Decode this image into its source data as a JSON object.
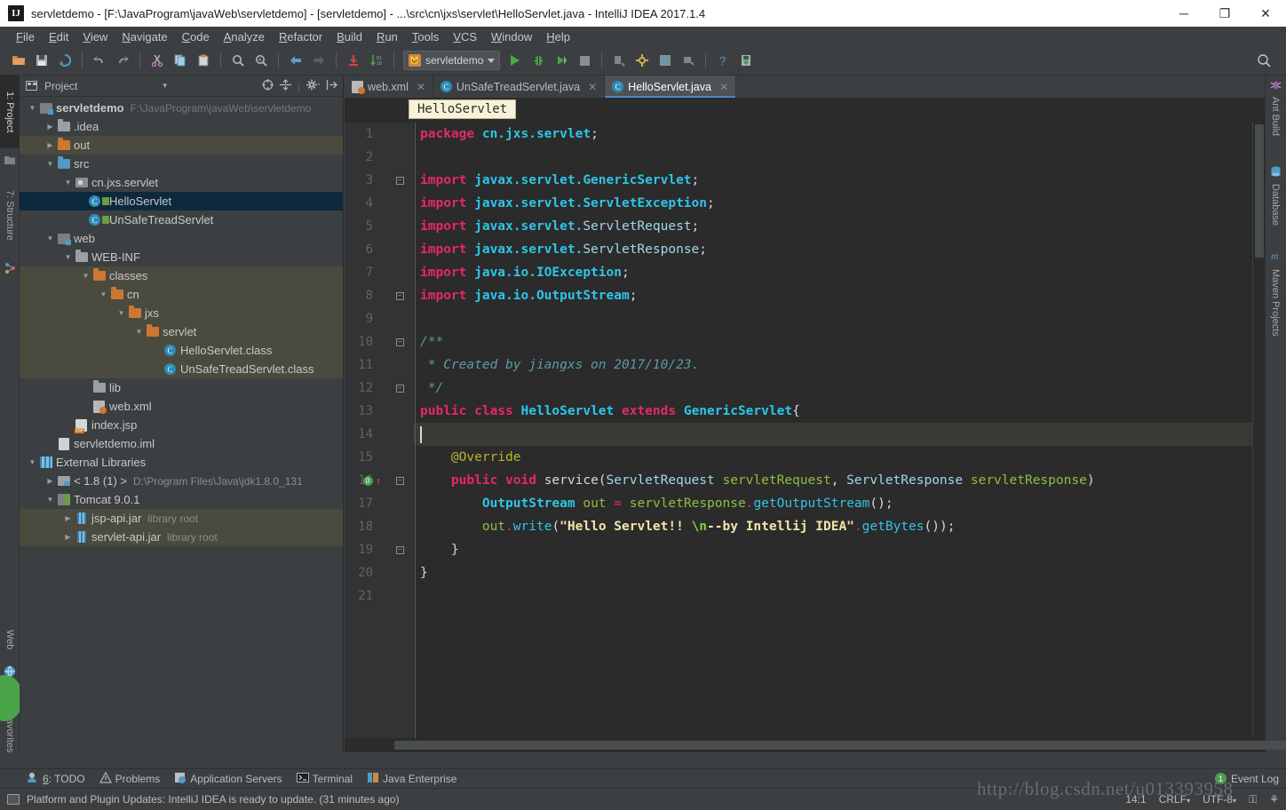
{
  "window": {
    "title": "servletdemo - [F:\\JavaProgram\\javaWeb\\servletdemo] - [servletdemo] - ...\\src\\cn\\jxs\\servlet\\HelloServlet.java - IntelliJ IDEA 2017.1.4",
    "logo": "IJ",
    "minimize": "─",
    "maximize": "❐",
    "close": "✕"
  },
  "menu": [
    "File",
    "Edit",
    "View",
    "Navigate",
    "Code",
    "Analyze",
    "Refactor",
    "Build",
    "Run",
    "Tools",
    "VCS",
    "Window",
    "Help"
  ],
  "toolbar": {
    "icons": [
      "open-folder-icon",
      "save-all-icon",
      "sync-icon",
      "undo-icon",
      "redo-icon",
      "cut-icon",
      "copy-icon",
      "paste-icon",
      "find-icon",
      "replace-icon",
      "back-icon",
      "forward-icon",
      "update-project-icon",
      "compare-icon"
    ],
    "run_config": "servletdemo",
    "run_icons": [
      "run-icon",
      "debug-icon",
      "run-coverage-icon",
      "stop-icon",
      "deploy-icon",
      "settings-icon",
      "project-structure-icon",
      "sdk-icon",
      "help-icon",
      "update-icon"
    ],
    "search": "⚲"
  },
  "left_strip": {
    "top_tabs": [
      {
        "label": "1: Project",
        "icon": "project-icon",
        "active": true
      },
      {
        "label": "7: Structure",
        "icon": "structure-icon",
        "active": false
      }
    ],
    "bottom_tabs": [
      {
        "label": "Web",
        "icon": "web-icon"
      },
      {
        "label": "2: Favorites",
        "icon": "star-icon"
      }
    ]
  },
  "right_strip": {
    "tabs": [
      {
        "label": "Ant Build",
        "icon": "ant-icon"
      },
      {
        "label": "Database",
        "icon": "database-icon"
      },
      {
        "label": "Maven Projects",
        "icon": "maven-icon"
      }
    ]
  },
  "project_panel": {
    "title": "Project",
    "dropdown": "▾",
    "tools": [
      "locate-icon",
      "collapse-all-icon",
      "settings-icon",
      "hide-icon"
    ],
    "tree": [
      {
        "depth": 0,
        "arrow": "open",
        "icon": "module-icon",
        "label": "servletdemo",
        "bold": true,
        "sub": "F:\\JavaProgram\\javaWeb\\servletdemo",
        "row": "plain"
      },
      {
        "depth": 1,
        "arrow": "closed",
        "icon": "folder-grey",
        "label": ".idea",
        "row": "plain"
      },
      {
        "depth": 1,
        "arrow": "closed",
        "icon": "folder-orange",
        "label": "out",
        "row": "tan"
      },
      {
        "depth": 1,
        "arrow": "open",
        "icon": "folder-blue",
        "label": "src",
        "row": "plain"
      },
      {
        "depth": 2,
        "arrow": "open",
        "icon": "package-icon",
        "label": "cn.jxs.servlet",
        "row": "plain"
      },
      {
        "depth": 3,
        "arrow": "none",
        "icon": "class-icon",
        "label": "HelloServlet",
        "row": "sel"
      },
      {
        "depth": 3,
        "arrow": "none",
        "icon": "class-icon",
        "label": "UnSafeTreadServlet",
        "row": "plain"
      },
      {
        "depth": 1,
        "arrow": "open",
        "icon": "folder-webroot",
        "label": "web",
        "row": "plain"
      },
      {
        "depth": 2,
        "arrow": "open",
        "icon": "folder-grey",
        "label": "WEB-INF",
        "row": "plain"
      },
      {
        "depth": 3,
        "arrow": "open",
        "icon": "folder-orange",
        "label": "classes",
        "row": "tan"
      },
      {
        "depth": 4,
        "arrow": "open",
        "icon": "folder-orange",
        "label": "cn",
        "row": "tan"
      },
      {
        "depth": 5,
        "arrow": "open",
        "icon": "folder-orange",
        "label": "jxs",
        "row": "tan"
      },
      {
        "depth": 6,
        "arrow": "open",
        "icon": "folder-orange",
        "label": "servlet",
        "row": "tan"
      },
      {
        "depth": 7,
        "arrow": "none",
        "icon": "class-file-icon",
        "label": "HelloServlet.class",
        "row": "tan"
      },
      {
        "depth": 7,
        "arrow": "none",
        "icon": "class-file-icon",
        "label": "UnSafeTreadServlet.class",
        "row": "tan"
      },
      {
        "depth": 3,
        "arrow": "none",
        "icon": "folder-grey",
        "label": "lib",
        "row": "plain"
      },
      {
        "depth": 3,
        "arrow": "none",
        "icon": "xml-file-icon",
        "label": "web.xml",
        "row": "plain"
      },
      {
        "depth": 2,
        "arrow": "none",
        "icon": "jsp-file-icon",
        "label": "index.jsp",
        "row": "plain"
      },
      {
        "depth": 1,
        "arrow": "none",
        "icon": "iml-file-icon",
        "label": "servletdemo.iml",
        "row": "plain"
      },
      {
        "depth": 0,
        "arrow": "open",
        "icon": "libraries-icon",
        "label": "External Libraries",
        "row": "plain"
      },
      {
        "depth": 1,
        "arrow": "closed",
        "icon": "jdk-icon",
        "label": "< 1.8 (1) >",
        "sub2": "D:\\Program Files\\Java\\jdk1.8.0_131",
        "row": "plain"
      },
      {
        "depth": 1,
        "arrow": "open",
        "icon": "tomcat-icon",
        "label": "Tomcat 9.0.1",
        "row": "plain"
      },
      {
        "depth": 2,
        "arrow": "closed",
        "icon": "jar-icon",
        "label": "jsp-api.jar",
        "sub2": "library root",
        "row": "tan"
      },
      {
        "depth": 2,
        "arrow": "closed",
        "icon": "jar-icon",
        "label": "servlet-api.jar",
        "sub2": "library root",
        "row": "tan"
      }
    ]
  },
  "editor": {
    "tabs": [
      {
        "label": "web.xml",
        "icon": "xml-file-icon",
        "active": false,
        "close": "✕"
      },
      {
        "label": "UnSafeTreadServlet.java",
        "icon": "class-icon",
        "active": false,
        "close": "✕"
      },
      {
        "label": "HelloServlet.java",
        "icon": "class-icon",
        "active": true,
        "close": "✕"
      }
    ],
    "breadcrumb": "HelloServlet",
    "lines": [
      {
        "n": "1",
        "fold": "",
        "over": false,
        "caret": false,
        "tokens": [
          {
            "t": "package ",
            "c": "kw"
          },
          {
            "t": "cn.jxs.servlet",
            "c": "cls"
          },
          {
            "t": ";",
            "c": "punc"
          }
        ]
      },
      {
        "n": "2",
        "fold": "",
        "over": false,
        "caret": false,
        "tokens": []
      },
      {
        "n": "3",
        "fold": "top",
        "over": false,
        "caret": false,
        "tokens": [
          {
            "t": "import ",
            "c": "kw"
          },
          {
            "t": "javax.servlet.GenericServlet",
            "c": "cls"
          },
          {
            "t": ";",
            "c": "punc"
          }
        ]
      },
      {
        "n": "4",
        "fold": "",
        "over": false,
        "caret": false,
        "tokens": [
          {
            "t": "import ",
            "c": "kw"
          },
          {
            "t": "javax.servlet.ServletException",
            "c": "cls"
          },
          {
            "t": ";",
            "c": "punc"
          }
        ]
      },
      {
        "n": "5",
        "fold": "",
        "over": false,
        "caret": false,
        "tokens": [
          {
            "t": "import ",
            "c": "kw"
          },
          {
            "t": "javax.servlet.",
            "c": "cls"
          },
          {
            "t": "ServletRequest",
            "c": "cls-n"
          },
          {
            "t": ";",
            "c": "punc"
          }
        ]
      },
      {
        "n": "6",
        "fold": "",
        "over": false,
        "caret": false,
        "tokens": [
          {
            "t": "import ",
            "c": "kw"
          },
          {
            "t": "javax.servlet.",
            "c": "cls"
          },
          {
            "t": "ServletResponse",
            "c": "cls-n"
          },
          {
            "t": ";",
            "c": "punc"
          }
        ]
      },
      {
        "n": "7",
        "fold": "",
        "over": false,
        "caret": false,
        "tokens": [
          {
            "t": "import ",
            "c": "kw"
          },
          {
            "t": "java.io.IOException",
            "c": "cls"
          },
          {
            "t": ";",
            "c": "punc"
          }
        ]
      },
      {
        "n": "8",
        "fold": "bottom",
        "over": false,
        "caret": false,
        "tokens": [
          {
            "t": "import ",
            "c": "kw"
          },
          {
            "t": "java.io.OutputStream",
            "c": "cls"
          },
          {
            "t": ";",
            "c": "punc"
          }
        ]
      },
      {
        "n": "9",
        "fold": "",
        "over": false,
        "caret": false,
        "tokens": []
      },
      {
        "n": "10",
        "fold": "top",
        "over": false,
        "caret": false,
        "tokens": [
          {
            "t": "/**",
            "c": "com"
          }
        ]
      },
      {
        "n": "11",
        "fold": "",
        "over": false,
        "caret": false,
        "tokens": [
          {
            "t": " * Created by jiangxs on 2017/10/23.",
            "c": "com"
          }
        ]
      },
      {
        "n": "12",
        "fold": "bottom",
        "over": false,
        "caret": false,
        "tokens": [
          {
            "t": " */",
            "c": "com"
          }
        ]
      },
      {
        "n": "13",
        "fold": "",
        "over": false,
        "caret": false,
        "tokens": [
          {
            "t": "public class ",
            "c": "kw"
          },
          {
            "t": "HelloServlet",
            "c": "cls"
          },
          {
            "t": " extends ",
            "c": "kw"
          },
          {
            "t": "GenericServlet",
            "c": "cls"
          },
          {
            "t": "{",
            "c": "punc"
          }
        ]
      },
      {
        "n": "14",
        "fold": "",
        "over": false,
        "caret": true,
        "tokens": []
      },
      {
        "n": "15",
        "fold": "",
        "over": false,
        "caret": false,
        "tokens": [
          {
            "t": "    @Override",
            "c": "anno"
          }
        ]
      },
      {
        "n": "16",
        "fold": "top",
        "over": true,
        "caret": false,
        "tokens": [
          {
            "t": "    ",
            "c": "plain"
          },
          {
            "t": "public void ",
            "c": "kw"
          },
          {
            "t": "service",
            "c": "plain"
          },
          {
            "t": "(",
            "c": "punc"
          },
          {
            "t": "ServletRequest",
            "c": "cls-n"
          },
          {
            "t": " ",
            "c": "plain"
          },
          {
            "t": "servletRequest",
            "c": "var"
          },
          {
            "t": ", ",
            "c": "punc"
          },
          {
            "t": "ServletResponse",
            "c": "cls-n"
          },
          {
            "t": " ",
            "c": "plain"
          },
          {
            "t": "servletResponse",
            "c": "var"
          },
          {
            "t": ")",
            "c": "punc"
          }
        ]
      },
      {
        "n": "17",
        "fold": "",
        "over": false,
        "caret": false,
        "tokens": [
          {
            "t": "        ",
            "c": "plain"
          },
          {
            "t": "OutputStream",
            "c": "cls"
          },
          {
            "t": " ",
            "c": "plain"
          },
          {
            "t": "out",
            "c": "var"
          },
          {
            "t": " ",
            "c": "plain"
          },
          {
            "t": "=",
            "c": "dot-red"
          },
          {
            "t": " ",
            "c": "plain"
          },
          {
            "t": "servletResponse",
            "c": "var"
          },
          {
            "t": ".",
            "c": "dot-red"
          },
          {
            "t": "getOutputStream",
            "c": "meth"
          },
          {
            "t": "();",
            "c": "punc"
          }
        ]
      },
      {
        "n": "18",
        "fold": "",
        "over": false,
        "caret": false,
        "tokens": [
          {
            "t": "        ",
            "c": "plain"
          },
          {
            "t": "out",
            "c": "var"
          },
          {
            "t": ".",
            "c": "dot-red"
          },
          {
            "t": "write",
            "c": "meth"
          },
          {
            "t": "(",
            "c": "punc"
          },
          {
            "t": "\"Hello Servlet!! ",
            "c": "str"
          },
          {
            "t": "\\n",
            "c": "esc"
          },
          {
            "t": "--by Intellij IDEA\"",
            "c": "str"
          },
          {
            "t": ".",
            "c": "dot-red"
          },
          {
            "t": "getBytes",
            "c": "meth"
          },
          {
            "t": "());",
            "c": "punc"
          }
        ]
      },
      {
        "n": "19",
        "fold": "bottom",
        "over": false,
        "caret": false,
        "tokens": [
          {
            "t": "    }",
            "c": "punc"
          }
        ]
      },
      {
        "n": "20",
        "fold": "",
        "over": false,
        "caret": false,
        "tokens": [
          {
            "t": "}",
            "c": "punc"
          }
        ]
      },
      {
        "n": "21",
        "fold": "",
        "over": false,
        "caret": false,
        "tokens": []
      }
    ]
  },
  "bottom_tabs": [
    {
      "label": "6: TODO",
      "icon": "todo-icon",
      "underline": "6"
    },
    {
      "label": "Problems",
      "icon": "warning-icon"
    },
    {
      "label": "Application Servers",
      "icon": "app-servers-icon"
    },
    {
      "label": "Terminal",
      "icon": "terminal-icon"
    },
    {
      "label": "Java Enterprise",
      "icon": "java-ee-icon"
    }
  ],
  "event_log": {
    "label": "Event Log",
    "count": "1"
  },
  "status": {
    "message": "Platform and Plugin Updates: IntelliJ IDEA is ready to update. (31 minutes ago)",
    "caret_position": "14:1",
    "line_separator": "CRLF",
    "encoding": "UTF-8",
    "lock": "⚿",
    "inspection": "⚘"
  },
  "watermark": "http://blog.csdn.net/u013393958",
  "colors": {
    "accent": "#4a88c7",
    "keyword": "#e8266e",
    "class": "#2ec5e8",
    "string": "#f2e6a8",
    "comment": "#5e9aa5",
    "annotation": "#bbb529",
    "variable": "#8fbf3f",
    "selection": "#0d293e",
    "editor_bg": "#2b2b2b",
    "panel_bg": "#3c3f41"
  }
}
